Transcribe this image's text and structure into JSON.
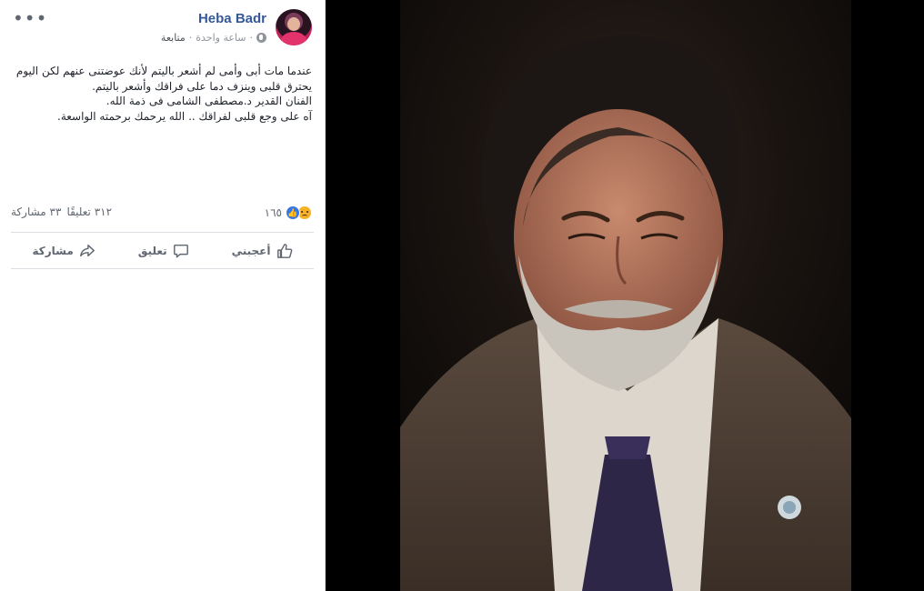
{
  "post": {
    "author": "Heba Badr",
    "follow": "متابعة",
    "separator": "·",
    "time": "ساعة واحدة",
    "text_lines": [
      "عندما مات أبى وأمى لم أشعر باليتم لأنك عوضتنى عنهم لكن اليوم",
      "يحترق قلبى وينزف دما على فراقك وأشعر باليتم.",
      "الفنان القدير د.مصطفى الشامى فى ذمة الله.",
      "آه على وجع قلبى لفراقك .. الله يرحمك برحمته الواسعة."
    ]
  },
  "stats": {
    "reactions_count": "١٦٥",
    "comments": "٣١٢ تعليقًا",
    "shares": "٣٣ مشاركة"
  },
  "actions": {
    "like": "أعجبني",
    "comment": "تعليق",
    "share": "مشاركة"
  },
  "icons": [
    "more-options-icon",
    "globe-icon",
    "like-reaction-icon",
    "sad-reaction-icon",
    "like-icon",
    "comment-icon",
    "share-icon"
  ],
  "colors": {
    "author_link": "#365899",
    "like_blue": "#3578e5",
    "sad_yellow": "#f7b125",
    "muted": "#606770"
  }
}
